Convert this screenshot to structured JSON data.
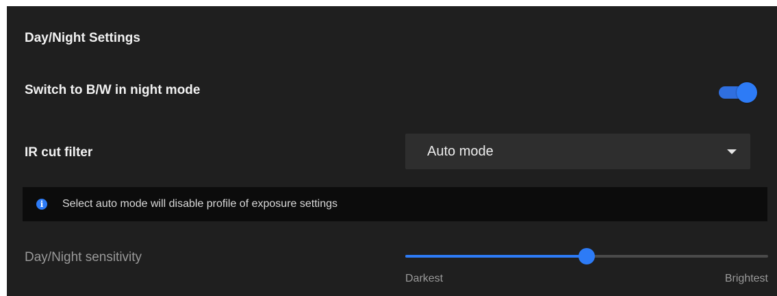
{
  "section": {
    "title": "Day/Night Settings"
  },
  "bw_switch": {
    "label": "Switch to B/W in night mode",
    "enabled": true
  },
  "ir_cut": {
    "label": "IR cut filter",
    "selected": "Auto mode"
  },
  "info": {
    "icon": "info-icon",
    "message": "Select auto mode will disable profile of exposure settings"
  },
  "sensitivity": {
    "label": "Day/Night sensitivity",
    "min_label": "Darkest",
    "max_label": "Brightest",
    "level": 0.5
  },
  "colors": {
    "accent": "#2d7bf6",
    "panel_bg": "#1f1f1f",
    "banner_bg": "#0c0c0c",
    "select_bg": "#2e2e2e"
  }
}
